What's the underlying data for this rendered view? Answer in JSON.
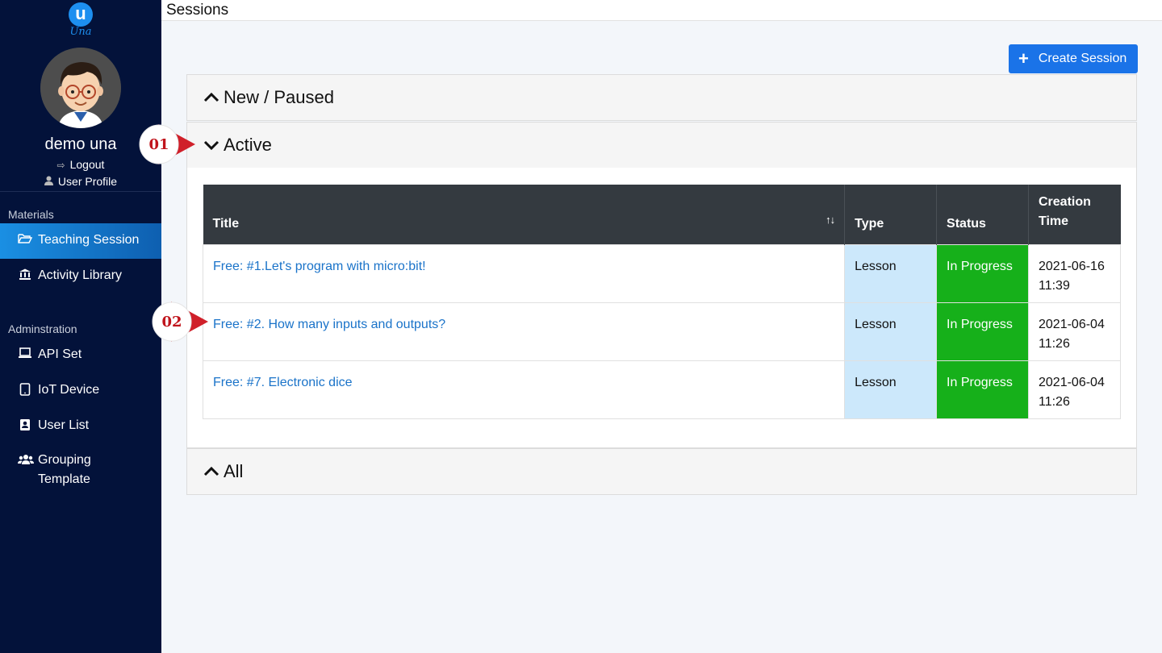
{
  "app": {
    "logo_text": "Una",
    "logo_letter": "u"
  },
  "user": {
    "name": "demo una",
    "logout": "Logout",
    "profile": "User Profile"
  },
  "sidebar": {
    "materials_label": "Materials",
    "admin_label": "Adminstration",
    "items": [
      {
        "label": "Teaching Session",
        "icon": "folder-open-icon",
        "active": true
      },
      {
        "label": "Activity Library",
        "icon": "bank-icon",
        "active": false
      },
      {
        "label": "API Set",
        "icon": "laptop-icon",
        "active": false
      },
      {
        "label": "IoT Device",
        "icon": "tablet-icon",
        "active": false
      },
      {
        "label": "User List",
        "icon": "contact-card-icon",
        "active": false
      },
      {
        "label": "Grouping Template",
        "icon": "users-icon",
        "active": false
      }
    ]
  },
  "topbar": {
    "title": "Sessions"
  },
  "actions": {
    "create_label": "Create Session"
  },
  "panels": {
    "new_paused": "New / Paused",
    "active": "Active",
    "all": "All"
  },
  "table": {
    "headers": {
      "title": "Title",
      "type": "Type",
      "status": "Status",
      "creation": "Creation Time"
    },
    "rows": [
      {
        "title": "Free: #1.Let's program with micro:bit!",
        "type": "Lesson",
        "status": "In Progress",
        "date": "2021-06-16",
        "time": "11:39"
      },
      {
        "title": "Free: #2. How many inputs and outputs?",
        "type": "Lesson",
        "status": "In Progress",
        "date": "2021-06-04",
        "time": "11:26"
      },
      {
        "title": "Free: #7. Electronic dice",
        "type": "Lesson",
        "status": "In Progress",
        "date": "2021-06-04",
        "time": "11:26"
      }
    ]
  },
  "annotations": {
    "step1": "01",
    "step2": "02"
  },
  "colors": {
    "sidebar_bg": "#03123a",
    "accent": "#1a73e8",
    "status_green": "#16b01a",
    "type_blue": "#cce8fb",
    "badge_red": "#d0202a"
  }
}
